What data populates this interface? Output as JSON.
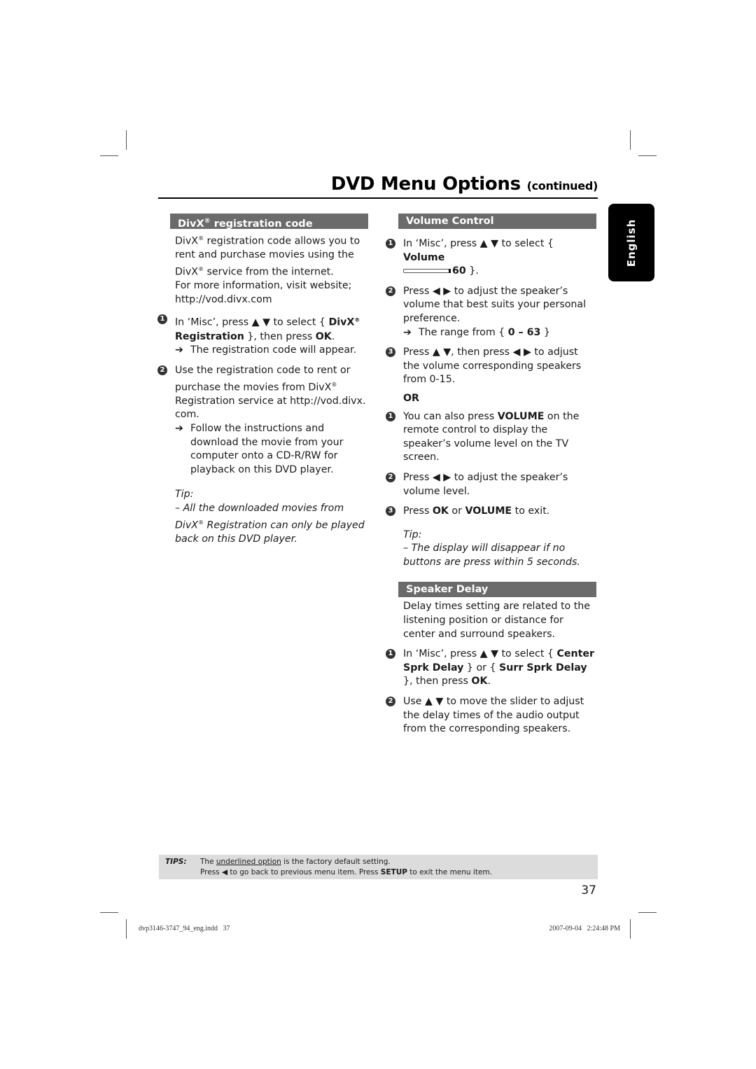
{
  "header": {
    "title": "DVD Menu Options",
    "subtitle": "(continued)"
  },
  "language_tab": "English",
  "divx": {
    "heading": "DivX",
    "heading_sup": "®",
    "heading_rest": " registration code",
    "intro_1a": "DivX",
    "intro_1b": " registration code allows you to rent and purchase movies using the ",
    "intro_1c": "DivX",
    "intro_1d": " service from the internet.",
    "intro_2": "For more information, visit website; http://vod.divx.com",
    "step1": {
      "number": "1",
      "pre": "In ‘Misc’, press ▲ ▼ to select { ",
      "bold": "DivX",
      "bold2": "Registration",
      "post": " }, then press ",
      "ok": "OK",
      "end": ".",
      "result": "The registration code will appear."
    },
    "step2": {
      "number": "2",
      "text_a": "Use the registration code to rent or purchase the movies from DivX",
      "text_b": " Registration service at http://vod.divx. com.",
      "result": "Follow the instructions and download the movie from your computer onto a CD-R/RW for playback on this DVD player."
    },
    "tip_label": "Tip:",
    "tip_a": "– All the downloaded movies from DivX",
    "tip_b": " Registration can only be played back on this DVD player."
  },
  "volume": {
    "heading": "Volume Control",
    "step1": {
      "number": "1",
      "pre": "In ‘Misc’, press ▲ ▼ to select { ",
      "bold": "Volume",
      "value": "60",
      "end": " }."
    },
    "step2": {
      "number": "2",
      "text": "Press ◀ ▶ to adjust the speaker’s volume that best suits your personal preference.",
      "result_pre": "The range from { ",
      "result_bold": "0 – 63",
      "result_end": " }"
    },
    "step3": {
      "number": "3",
      "text": "Press ▲ ▼, then press ◀ ▶ to adjust the volume corresponding speakers from 0-15."
    },
    "or": "OR",
    "alt1": {
      "number": "1",
      "pre": "You can also press ",
      "bold": "VOLUME",
      "post": " on the remote control to display the speaker’s volume level on the TV screen."
    },
    "alt2": {
      "number": "2",
      "text": "Press ◀ ▶ to adjust the speaker’s volume level."
    },
    "alt3": {
      "number": "3",
      "pre": "Press ",
      "bold1": "OK",
      "mid": " or ",
      "bold2": "VOLUME",
      "post": " to exit."
    },
    "tip_label": "Tip:",
    "tip": "– The display will disappear if no buttons are press within 5 seconds."
  },
  "speaker_delay": {
    "heading": "Speaker Delay",
    "intro": "Delay times setting are related to the listening position or distance for center and surround speakers.",
    "step1": {
      "number": "1",
      "pre": "In ‘Misc’, press ▲ ▼ to select { ",
      "bold1": "Center Sprk Delay",
      "mid": " } or { ",
      "bold2": "Surr Sprk Delay",
      "post": " }, then press ",
      "ok": "OK",
      "end": "."
    },
    "step2": {
      "number": "2",
      "text": "Use ▲ ▼ to move the slider to adjust the delay times of the audio output from the corresponding speakers."
    }
  },
  "tips_bar": {
    "label": "TIPS:",
    "line1_pre": "The ",
    "line1_u": "underlined option",
    "line1_post": " is the factory default setting.",
    "line2_pre": "Press ◀ to go back to previous menu item. Press ",
    "line2_bold": "SETUP",
    "line2_post": " to exit the menu item."
  },
  "page_number": "37",
  "slug": {
    "file": "dvp3146-3747_94_eng.indd   37",
    "date": "2007-09-04   2:24:48 PM"
  }
}
